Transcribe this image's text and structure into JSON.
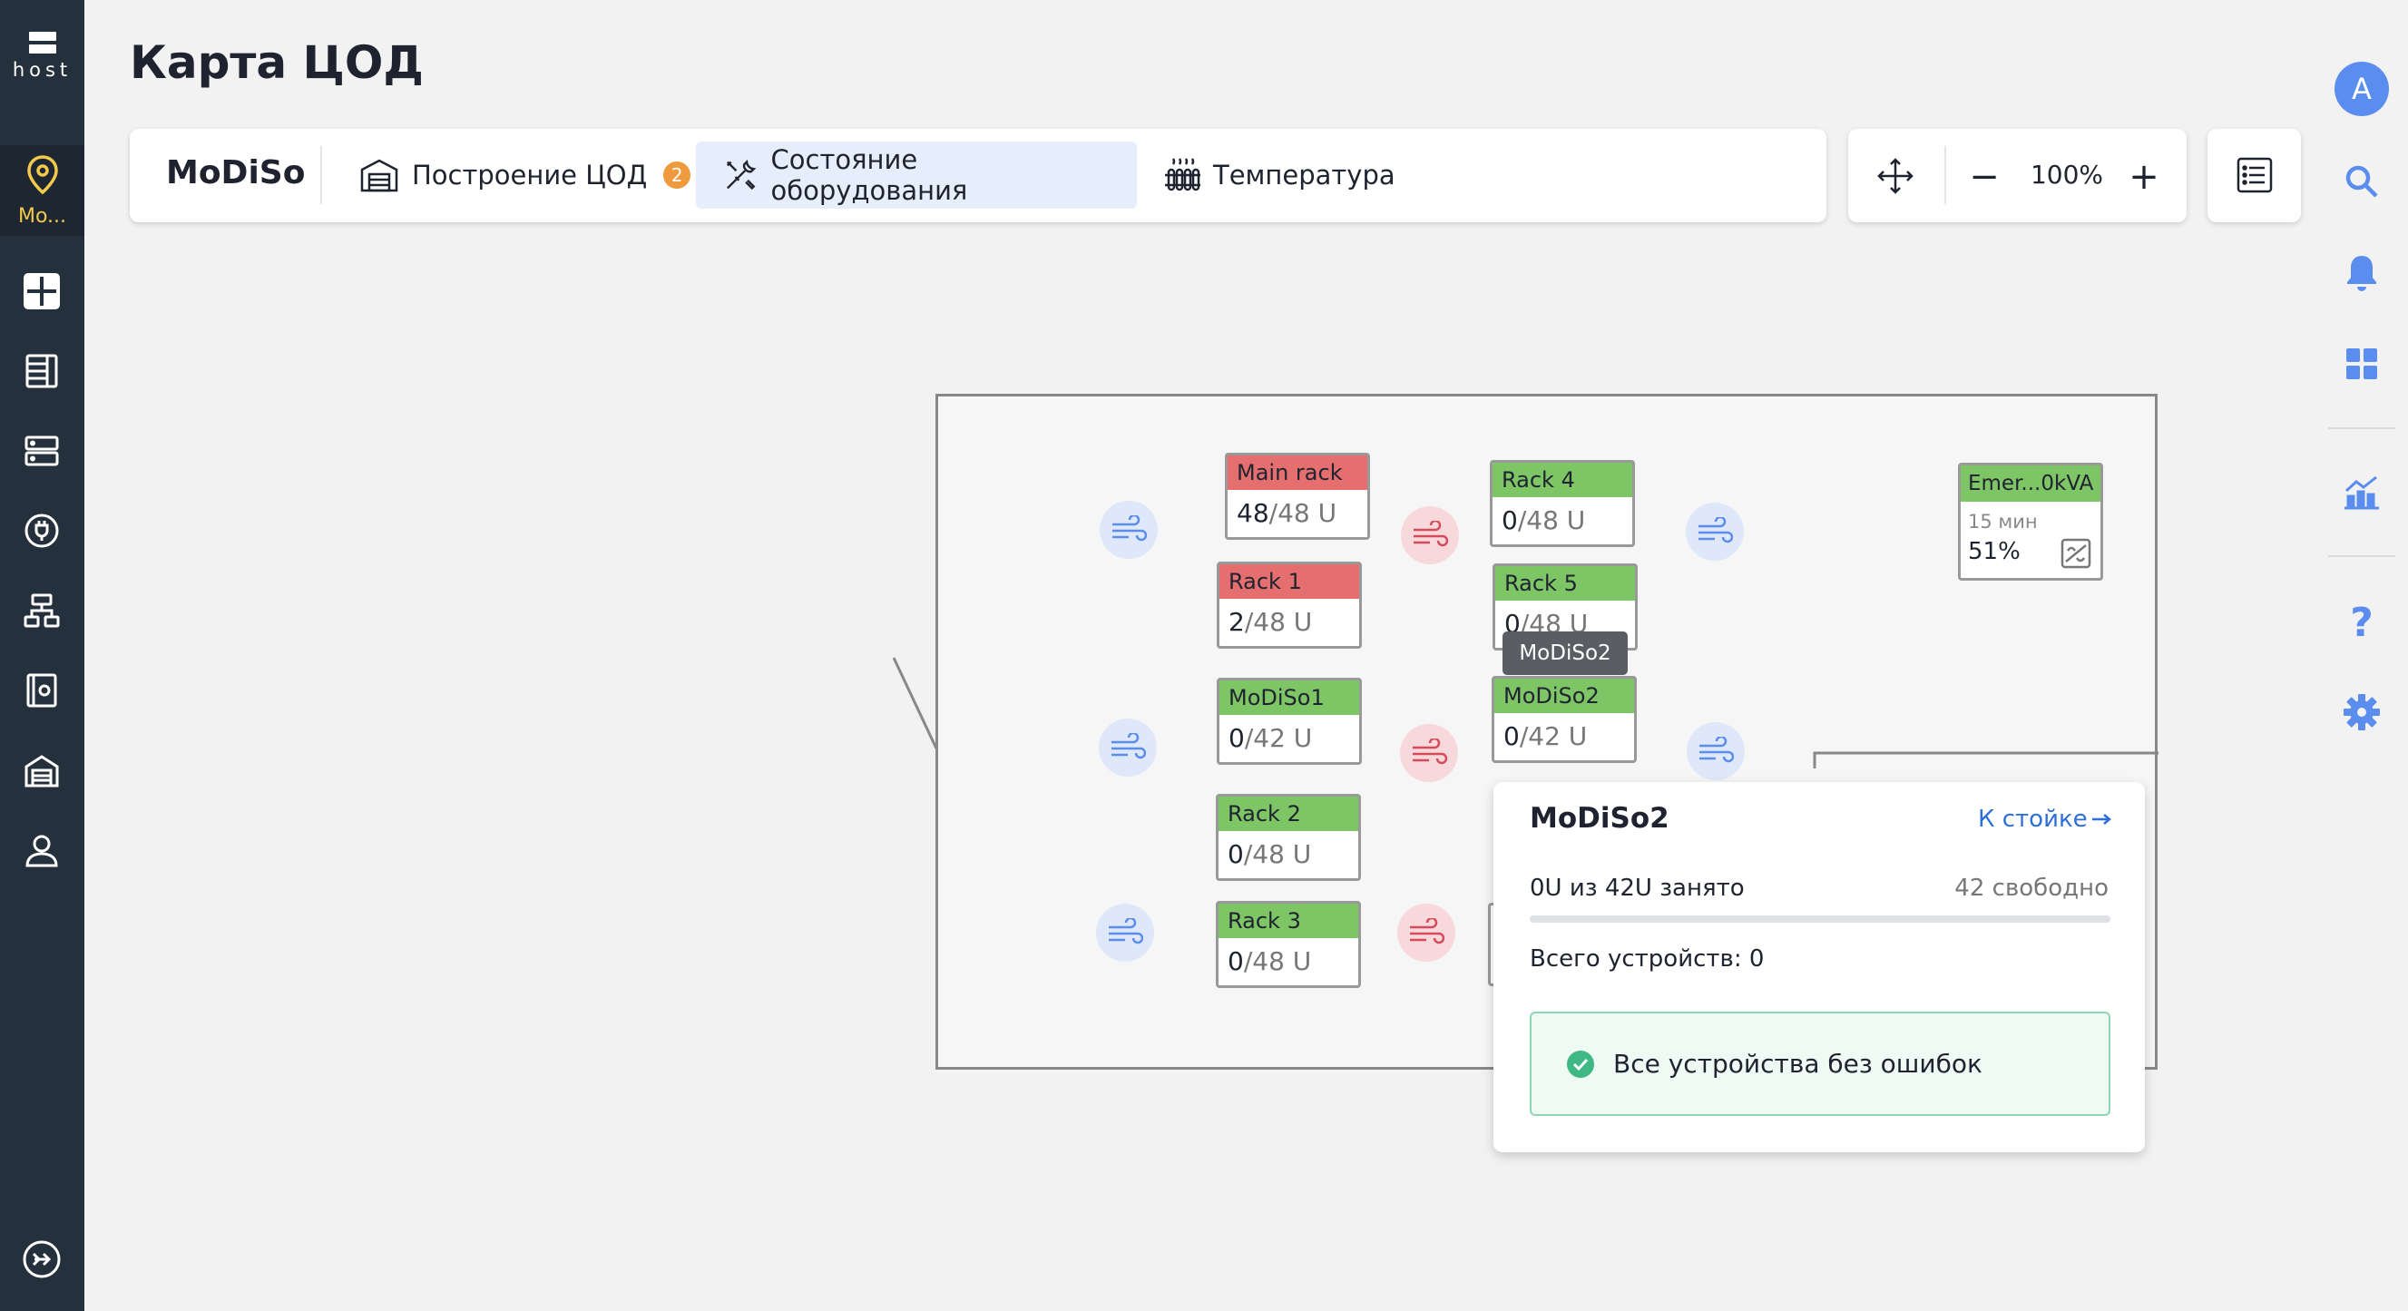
{
  "sidebar": {
    "logo_text": "host",
    "location_label": "Mo...",
    "nav_icons": [
      "dashboard-icon",
      "rack-list-icon",
      "server-icon",
      "power-plug-icon",
      "network-icon",
      "storage-icon",
      "datacenter-icon",
      "user-icon"
    ],
    "bottom_icon": "expand-sidebar-icon"
  },
  "header": {
    "title": "Карта ЦОД"
  },
  "tabbar": {
    "brand": "MoDiSo",
    "tabs": [
      {
        "label": "Построение ЦОД",
        "badge": "2",
        "active": false
      },
      {
        "label": "Состояние оборудования",
        "active": true
      },
      {
        "label": "Температура",
        "active": false
      }
    ]
  },
  "zoom": {
    "value": "100%",
    "minus": "−",
    "plus": "+"
  },
  "rightbar": {
    "avatar_letter": "A"
  },
  "map": {
    "racks": [
      {
        "name": "Main rack",
        "used": "48",
        "total": "/48 U",
        "status": "red"
      },
      {
        "name": "Rack 1",
        "used": "2",
        "total": "/48 U",
        "status": "red"
      },
      {
        "name": "MoDiSo1",
        "used": "0",
        "total": "/42 U",
        "status": "green"
      },
      {
        "name": "Rack 2",
        "used": "0",
        "total": "/48 U",
        "status": "green"
      },
      {
        "name": "Rack 3",
        "used": "0",
        "total": "/48 U",
        "status": "green"
      },
      {
        "name": "Rack 4",
        "used": "0",
        "total": "/48 U",
        "status": "green"
      },
      {
        "name": "Rack 5",
        "used": "0",
        "total": "/48 U",
        "status": "green"
      },
      {
        "name": "MoDiSo2",
        "used": "0",
        "total": "/42 U",
        "status": "green"
      }
    ],
    "ups": {
      "name": "Emer...0kVA",
      "time": "15 мин",
      "charge": "51%"
    },
    "tooltip": "MoDiSo2"
  },
  "popup": {
    "title": "MoDiSo2",
    "link": "К стойке",
    "occupancy": "0U из 42U занято",
    "free": "42 свободно",
    "occupancy_fraction": 0,
    "devices": "Всего устройств: 0",
    "status": "Все устройства без ошибок"
  },
  "colors": {
    "accent": "#5b8def",
    "rack_error": "#e56f6f",
    "rack_ok": "#7ec565",
    "location": "#f2c94c"
  }
}
